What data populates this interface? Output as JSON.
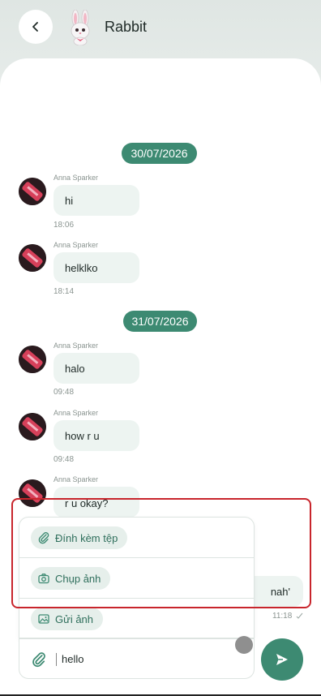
{
  "header": {
    "title": "Rabbit",
    "back_icon": "chevron-left-icon",
    "logo": "rabbit-logo"
  },
  "dates": [
    "30/07/2026",
    "31/07/2026"
  ],
  "messages": [
    {
      "sender": "Anna Sparker",
      "text": "hi",
      "time": "18:06"
    },
    {
      "sender": "Anna Sparker",
      "text": "helklko",
      "time": "18:14"
    },
    {
      "sender": "Anna Sparker",
      "text": "halo",
      "time": "09:48"
    },
    {
      "sender": "Anna Sparker",
      "text": "how r u",
      "time": "09:48"
    },
    {
      "sender": "Anna Sparker",
      "text": "r u okay?",
      "time": ""
    }
  ],
  "outgoing": {
    "text": "nah'",
    "time": "11:18"
  },
  "attach_menu": {
    "items": [
      {
        "label": "Đính kèm tệp",
        "icon": "paperclip-icon"
      },
      {
        "label": "Chụp ảnh",
        "icon": "camera-icon"
      },
      {
        "label": "Gửi ảnh",
        "icon": "image-icon"
      }
    ]
  },
  "composer": {
    "value": "hello",
    "attach_icon": "paperclip-icon",
    "send_icon": "send-icon"
  },
  "colors": {
    "accent": "#3d8a72",
    "bubble": "#edf4f1",
    "highlight": "#c8252c"
  }
}
